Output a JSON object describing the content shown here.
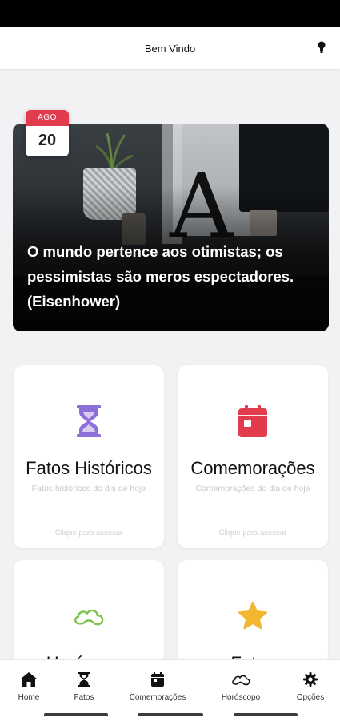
{
  "header": {
    "title": "Bem Vindo",
    "icon": "lightbulb-icon"
  },
  "hero": {
    "date": {
      "month": "AGO",
      "day": "20"
    },
    "quote": "O mundo pertence aos otimistas; os pessimistas são meros espectadores. (Eisenhower)",
    "image_letter": "A"
  },
  "cards": [
    {
      "title": "Fatos Históricos",
      "subtitle": "Fatos históricos do dia de hoje",
      "cta": "Clique para acessar",
      "icon": "hourglass-icon",
      "icon_color": "#8e6fd8"
    },
    {
      "title": "Comemorações",
      "subtitle": "Comemorações do dia de hoje",
      "cta": "Clique para acessar",
      "icon": "calendar-icon",
      "icon_color": "#e23b4e"
    },
    {
      "title": "Horóscopo",
      "icon": "cloud-horoscope-icon",
      "icon_color": "#7cc44a"
    },
    {
      "title": "Fatos",
      "icon": "star-icon",
      "icon_color": "#f2b731"
    }
  ],
  "bottom_nav": [
    {
      "label": "Home",
      "icon": "home-icon"
    },
    {
      "label": "Fatos",
      "icon": "hourglass-icon"
    },
    {
      "label": "Comemorações",
      "icon": "calendar-icon"
    },
    {
      "label": "Horóscopo",
      "icon": "cloud-icon"
    },
    {
      "label": "Opções",
      "icon": "gear-icon"
    }
  ],
  "colors": {
    "accent_red": "#e23b4e",
    "purple": "#8e6fd8",
    "green": "#7cc44a",
    "yellow": "#f2b731",
    "background": "#f2f2f5"
  }
}
